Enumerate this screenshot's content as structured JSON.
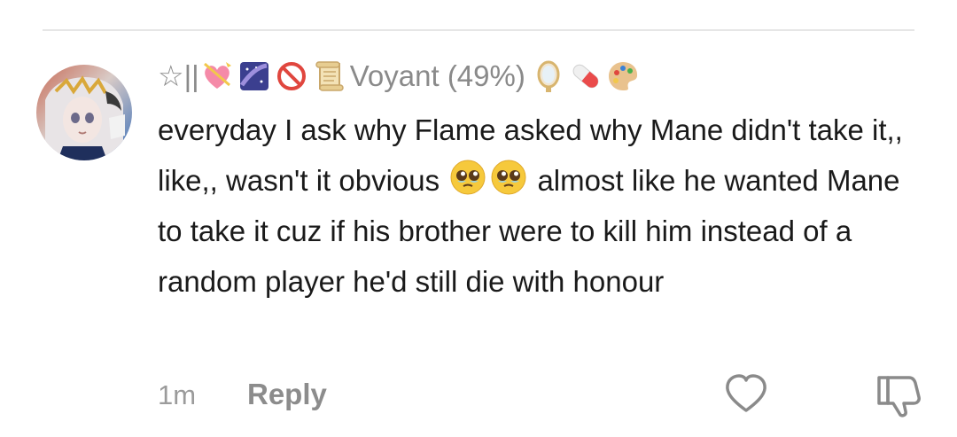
{
  "comment": {
    "username_prefix": "☆||",
    "username": "Voyant (49%)",
    "username_emojis_before": [
      "heart-ribbon-icon",
      "night-sky-icon",
      "prohibited-icon",
      "scroll-icon"
    ],
    "username_emojis_after": [
      "mirror-icon",
      "pill-icon",
      "palette-icon"
    ],
    "body_part1": "everyday I ask why Flame asked why Mane didn't take it,, like,, wasn't it obvious ",
    "body_emojis": [
      "pleading-face-icon",
      "pleading-face-icon"
    ],
    "body_part2": " almost like he wanted Mane to take it cuz if his brother were to kill him instead of a random player he'd still die with honour",
    "time": "1m",
    "reply_label": "Reply"
  },
  "colors": {
    "username": "#8a8a8a",
    "body": "#1a1a1a",
    "meta": "#9b9b9b",
    "divider": "#e6e6e6"
  }
}
